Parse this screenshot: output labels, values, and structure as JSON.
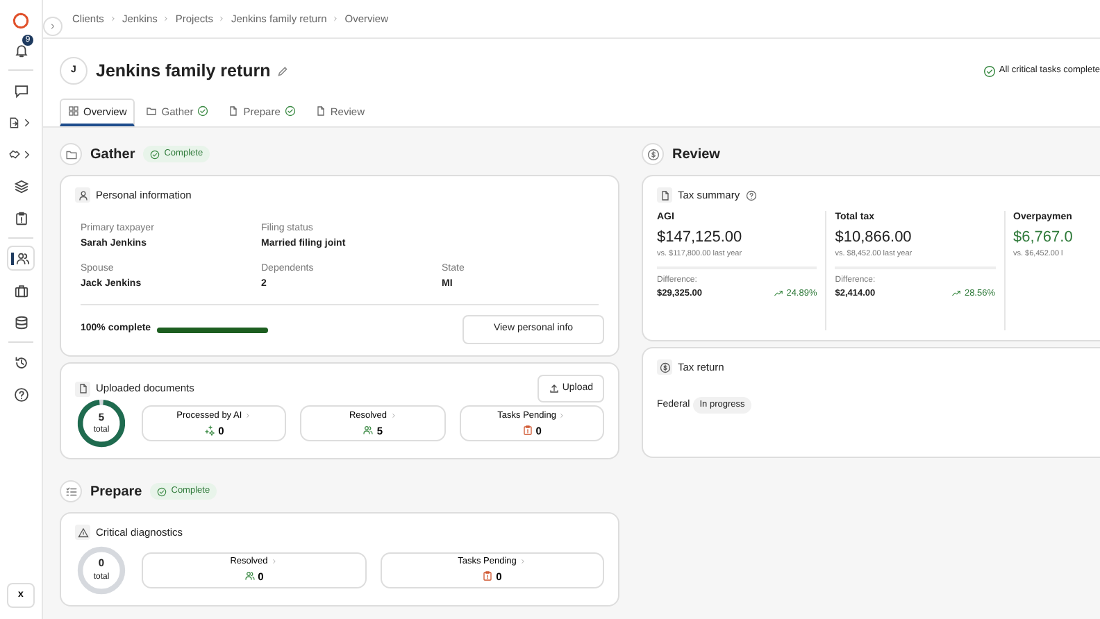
{
  "sidebar": {
    "notification_count": "9",
    "items": [
      {
        "selected": false,
        "submenu": false
      },
      {
        "selected": false,
        "submenu": true
      },
      {
        "selected": false,
        "submenu": true
      },
      {
        "selected": false,
        "submenu": false
      },
      {
        "selected": false,
        "submenu": false
      },
      {
        "selected": true,
        "submenu": false
      },
      {
        "selected": false,
        "submenu": false
      },
      {
        "selected": false,
        "submenu": false
      },
      {
        "selected": false,
        "submenu": false
      },
      {
        "selected": false,
        "submenu": false
      }
    ],
    "footer_key": "x"
  },
  "breadcrumb": [
    "Clients",
    "Jenkins",
    "Projects",
    "Jenkins family return",
    "Overview"
  ],
  "header": {
    "avatar": "J",
    "title": "Jenkins family return",
    "status": "All critical tasks complete"
  },
  "tabs": [
    {
      "label": "Overview",
      "selected": true,
      "complete": false
    },
    {
      "label": "Gather",
      "selected": false,
      "complete": true
    },
    {
      "label": "Prepare",
      "selected": false,
      "complete": true
    },
    {
      "label": "Review",
      "selected": false,
      "complete": false
    }
  ],
  "gather": {
    "title": "Gather",
    "badge": "Complete",
    "personal": {
      "title": "Personal information",
      "fields": [
        {
          "label": "Primary taxpayer",
          "value": "Sarah Jenkins"
        },
        {
          "label": "Filing status",
          "value": "Married filing joint"
        },
        {
          "label": "Spouse",
          "value": "Jack Jenkins"
        },
        {
          "label": "Dependents",
          "value": "2"
        },
        {
          "label": "State",
          "value": "MI"
        }
      ],
      "progress_label": "100% complete",
      "level": 1,
      "button": "View personal info"
    },
    "documents": {
      "title": "Uploaded documents",
      "button": "Upload",
      "ring": {
        "value": "5",
        "caption": "total",
        "level": 1
      },
      "stats": [
        {
          "label": "Processed by AI",
          "value": "0",
          "kind": "ai"
        },
        {
          "label": "Resolved",
          "value": "5",
          "kind": "resolved"
        },
        {
          "label": "Tasks Pending",
          "value": "0",
          "kind": "pending"
        }
      ]
    }
  },
  "prepare": {
    "title": "Prepare",
    "badge": "Complete",
    "diagnostics": {
      "title": "Critical diagnostics",
      "ring": {
        "value": "0",
        "caption": "total"
      },
      "stats": [
        {
          "label": "Resolved",
          "value": "0",
          "kind": "resolved"
        },
        {
          "label": "Tasks Pending",
          "value": "0",
          "kind": "pending"
        }
      ]
    }
  },
  "review": {
    "title": "Review",
    "summary": {
      "title": "Tax summary",
      "columns": [
        {
          "label": "AGI",
          "amount": "$147,125.00",
          "comparison": "vs. $117,800.00 last year",
          "difference_label": "Difference:",
          "difference": "$29,325.00",
          "change": "24.89%",
          "highlight": false
        },
        {
          "label": "Total tax",
          "amount": "$10,866.00",
          "comparison": "vs. $8,452.00 last year",
          "difference_label": "Difference:",
          "difference": "$2,414.00",
          "change": "28.56%",
          "highlight": false
        },
        {
          "label": "Overpaymen",
          "amount": "$6,767.0",
          "comparison": "vs. $6,452.00 l",
          "highlight": true
        }
      ]
    },
    "tax_return": {
      "title": "Tax return",
      "jurisdiction": "Federal",
      "status": "In progress"
    }
  }
}
